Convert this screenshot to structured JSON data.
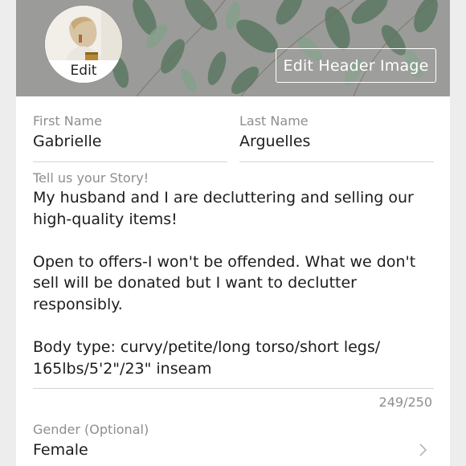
{
  "header": {
    "edit_header_label": "Edit Header Image"
  },
  "avatar": {
    "edit_label": "Edit"
  },
  "form": {
    "first_name": {
      "label": "First Name",
      "value": "Gabrielle"
    },
    "last_name": {
      "label": "Last Name",
      "value": "Arguelles"
    },
    "story": {
      "label": "Tell us your Story!",
      "value": "My husband and I are decluttering and selling our high-quality items!\n\nOpen to offers-I won't be offended. What we don't sell will be donated but I want to declutter responsibly.\n\nBody type: curvy/petite/long torso/short legs/ 165lbs/5'2\"/23\" inseam",
      "counter": "249/250"
    },
    "gender": {
      "label": "Gender (Optional)",
      "value": "Female"
    }
  },
  "icons": {
    "gender_chevron": "chevron-right-icon"
  },
  "colors": {
    "label": "#8e8e8e",
    "text": "#1d1d1d",
    "divider": "#d4d4d4"
  }
}
